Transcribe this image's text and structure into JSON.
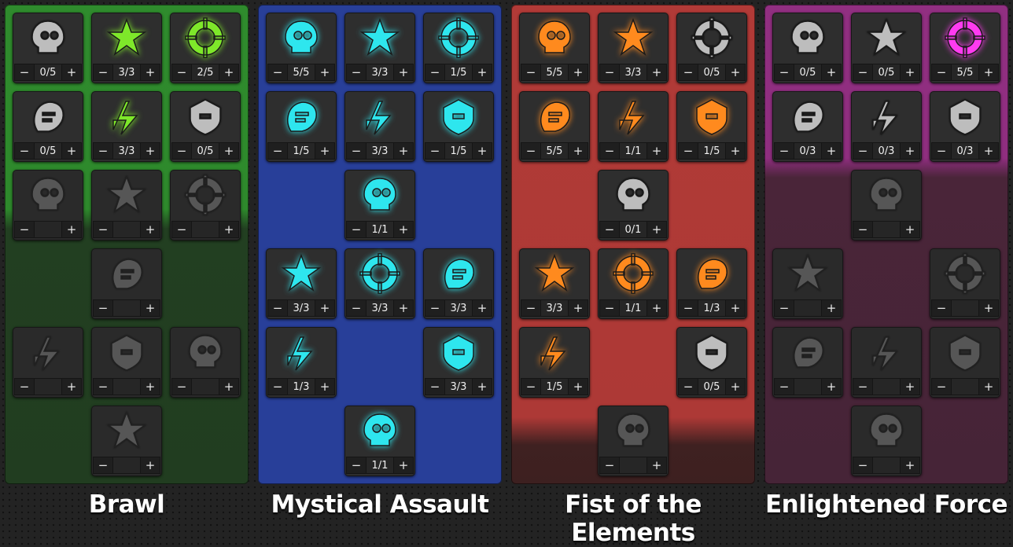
{
  "colors": {
    "brawl": "#2e8a2c",
    "brawl_dark": "#223f21",
    "brawl_icon": "#7ee82a",
    "mystical": "#29409a",
    "mystical_icon": "#2ee6ee",
    "fist": "#b13a37",
    "fist_dark": "#3d2020",
    "fist_icon": "#ff8a1e",
    "enlightened": "#912f81",
    "enlightened_dark": "#462437",
    "enlightened_icon": "#ff3bf0",
    "inactive_icon": "#bdbdbd"
  },
  "trees": [
    {
      "title": "Brawl",
      "skills": [
        {
          "row": 0,
          "col": 0,
          "icon": "stump-icon",
          "state": "inactive",
          "count": "0/5"
        },
        {
          "row": 0,
          "col": 1,
          "icon": "grenade-skull-icon",
          "state": "active",
          "count": "3/3"
        },
        {
          "row": 0,
          "col": 2,
          "icon": "glowing-fist-icon",
          "state": "active",
          "count": "2/5"
        },
        {
          "row": 1,
          "col": 0,
          "icon": "tentacle-icon",
          "state": "inactive",
          "count": "0/5"
        },
        {
          "row": 1,
          "col": 1,
          "icon": "skull-crate-icon",
          "state": "active",
          "count": "3/3"
        },
        {
          "row": 1,
          "col": 2,
          "icon": "spin-icon",
          "state": "inactive",
          "count": "0/5"
        },
        {
          "row": 2,
          "col": 0,
          "icon": "shield-bandage-icon",
          "state": "locked",
          "count": ""
        },
        {
          "row": 2,
          "col": 1,
          "icon": "scythe-icon",
          "state": "locked",
          "count": ""
        },
        {
          "row": 2,
          "col": 2,
          "icon": "rabbit-icon",
          "state": "locked",
          "count": ""
        },
        {
          "row": 3,
          "col": 1,
          "icon": "drill-icon",
          "state": "locked",
          "count": ""
        },
        {
          "row": 4,
          "col": 0,
          "icon": "crate-burst-icon",
          "state": "locked",
          "count": ""
        },
        {
          "row": 4,
          "col": 1,
          "icon": "skull-crossbones-icon",
          "state": "locked",
          "count": ""
        },
        {
          "row": 4,
          "col": 2,
          "icon": "angel-icon",
          "state": "locked",
          "count": ""
        },
        {
          "row": 5,
          "col": 1,
          "icon": "bomb-icon",
          "state": "locked",
          "count": ""
        }
      ]
    },
    {
      "title": "Mystical Assault",
      "skills": [
        {
          "row": 0,
          "col": 0,
          "icon": "double-skull-icon",
          "state": "active",
          "count": "5/5"
        },
        {
          "row": 0,
          "col": 1,
          "icon": "winged-gun-icon",
          "state": "active",
          "count": "3/3"
        },
        {
          "row": 0,
          "col": 2,
          "icon": "skull-banner-icon",
          "state": "active",
          "count": "1/5"
        },
        {
          "row": 1,
          "col": 0,
          "icon": "arrow-shot-icon",
          "state": "active",
          "count": "1/5"
        },
        {
          "row": 1,
          "col": 1,
          "icon": "crosshair-icon",
          "state": "active",
          "count": "3/3"
        },
        {
          "row": 1,
          "col": 2,
          "icon": "hourglass-icon",
          "state": "active",
          "count": "1/5"
        },
        {
          "row": 2,
          "col": 1,
          "icon": "rising-arrow-icon",
          "state": "active",
          "count": "1/1"
        },
        {
          "row": 3,
          "col": 0,
          "icon": "bullet-spark-icon",
          "state": "active",
          "count": "3/3"
        },
        {
          "row": 3,
          "col": 1,
          "icon": "dagger-skull-icon",
          "state": "active",
          "count": "3/3"
        },
        {
          "row": 3,
          "col": 2,
          "icon": "crossed-blades-icon",
          "state": "active",
          "count": "3/3"
        },
        {
          "row": 4,
          "col": 0,
          "icon": "vortex-icon",
          "state": "active",
          "count": "1/3"
        },
        {
          "row": 4,
          "col": 2,
          "icon": "crowned-skull-icon",
          "state": "active",
          "count": "3/3"
        },
        {
          "row": 5,
          "col": 1,
          "icon": "seal-icon",
          "state": "active",
          "count": "1/1"
        }
      ]
    },
    {
      "title": "Fist of the Elements",
      "skills": [
        {
          "row": 0,
          "col": 0,
          "icon": "flame-hourglass-icon",
          "state": "active",
          "count": "5/5"
        },
        {
          "row": 0,
          "col": 1,
          "icon": "target-fist-icon",
          "state": "active",
          "count": "3/3"
        },
        {
          "row": 0,
          "col": 2,
          "icon": "film-reel-icon",
          "state": "inactive",
          "count": "0/5"
        },
        {
          "row": 1,
          "col": 0,
          "icon": "exploding-skull-icon",
          "state": "active",
          "count": "5/5"
        },
        {
          "row": 1,
          "col": 1,
          "icon": "hand-spark-icon",
          "state": "active",
          "count": "1/1"
        },
        {
          "row": 1,
          "col": 2,
          "icon": "triple-skull-icon",
          "state": "active",
          "count": "1/5"
        },
        {
          "row": 2,
          "col": 1,
          "icon": "skull-hands-icon",
          "state": "inactive",
          "count": "0/1"
        },
        {
          "row": 3,
          "col": 0,
          "icon": "lightning-bullet-icon",
          "state": "active",
          "count": "3/3"
        },
        {
          "row": 3,
          "col": 1,
          "icon": "burning-bar-icon",
          "state": "active",
          "count": "1/1"
        },
        {
          "row": 3,
          "col": 2,
          "icon": "nuke-skull-icon",
          "state": "active",
          "count": "1/3"
        },
        {
          "row": 4,
          "col": 0,
          "icon": "heart-fist-icon",
          "state": "active",
          "count": "1/5"
        },
        {
          "row": 4,
          "col": 2,
          "icon": "yin-yang-icon",
          "state": "inactive",
          "count": "0/5"
        },
        {
          "row": 5,
          "col": 1,
          "icon": "pistol-icon",
          "state": "locked",
          "count": ""
        }
      ]
    },
    {
      "title": "Enlightened Force",
      "skills": [
        {
          "row": 0,
          "col": 0,
          "icon": "shield-crest-icon",
          "state": "inactive",
          "count": "0/5"
        },
        {
          "row": 0,
          "col": 1,
          "icon": "fist-punch-icon",
          "state": "inactive",
          "count": "0/5"
        },
        {
          "row": 0,
          "col": 2,
          "icon": "winged-boot-icon",
          "state": "active",
          "count": "5/5"
        },
        {
          "row": 1,
          "col": 0,
          "icon": "bottle-icon",
          "state": "inactive",
          "count": "0/3"
        },
        {
          "row": 1,
          "col": 1,
          "icon": "turtle-shell-icon",
          "state": "inactive",
          "count": "0/3"
        },
        {
          "row": 1,
          "col": 2,
          "icon": "heal-fist-icon",
          "state": "inactive",
          "count": "0/3"
        },
        {
          "row": 2,
          "col": 1,
          "icon": "fist-burst-icon",
          "state": "locked",
          "count": ""
        },
        {
          "row": 3,
          "col": 0,
          "icon": "fist-up-icon",
          "state": "locked",
          "count": ""
        },
        {
          "row": 3,
          "col": 2,
          "icon": "woman-face-icon",
          "state": "locked",
          "count": ""
        },
        {
          "row": 4,
          "col": 0,
          "icon": "sword-splash-icon",
          "state": "locked",
          "count": ""
        },
        {
          "row": 4,
          "col": 1,
          "icon": "shards-icon",
          "state": "locked",
          "count": ""
        },
        {
          "row": 4,
          "col": 2,
          "icon": "starburst-icon",
          "state": "locked",
          "count": ""
        },
        {
          "row": 5,
          "col": 1,
          "icon": "shovel-icon",
          "state": "locked",
          "count": ""
        }
      ]
    }
  ]
}
